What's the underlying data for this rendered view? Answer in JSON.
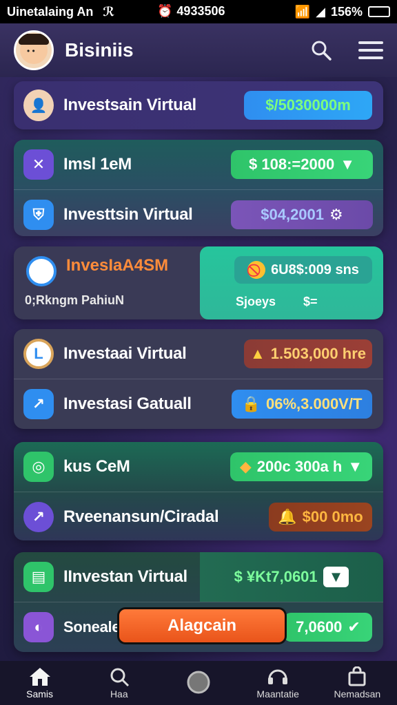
{
  "status": {
    "left_text": "Uinetalaing An",
    "left_extra": "ℛ",
    "center_text": "4933506",
    "battery_text": "156%"
  },
  "header": {
    "title": "Bisiniis"
  },
  "cards": {
    "c1": {
      "label": "Investsain Virtual",
      "value": "$/5030000m"
    },
    "c2a": {
      "label": "Imsl 1eM",
      "value": "$ 108:=2000"
    },
    "c2b": {
      "label": "Investtsin Virtual",
      "value": "$04,2001"
    },
    "c3": {
      "label": "InvesIaA4SM",
      "sub": "0;Rkngm PahiuN",
      "value_top": "6U8$:009 sns",
      "value_bottom_left": "Sjoeys",
      "value_bottom_right": "$="
    },
    "c4a": {
      "label": "Investaai Virtual",
      "value": "1.503,000 hre"
    },
    "c4b": {
      "label": "Investasi Gatuall",
      "value": "06%,3.000V/T"
    },
    "c5a": {
      "label": "kus CeM",
      "value": "200c 300a h"
    },
    "c5b": {
      "label": "Rveenansun/Ciradal",
      "value": "$00 0mo"
    },
    "c6a": {
      "label": "IInvestan Virtual",
      "value": "$ ¥Kt7,0601"
    },
    "c6b": {
      "label": "Soneale",
      "value": "7,0600"
    }
  },
  "float_button": "Alagcain",
  "nav": [
    {
      "label": "Samis",
      "icon": "home-icon"
    },
    {
      "label": "Haa",
      "icon": "search-icon"
    },
    {
      "label": "",
      "icon": "circle-icon"
    },
    {
      "label": "Maantatie",
      "icon": "headset-icon"
    },
    {
      "label": "Nemadsan",
      "icon": "bag-icon"
    }
  ],
  "colors": {
    "accent_blue": "#2f8ef0",
    "accent_green": "#2fc46a",
    "accent_purple": "#7b55b8",
    "accent_orange": "#e9541a",
    "accent_teal": "#2fc9a6"
  }
}
